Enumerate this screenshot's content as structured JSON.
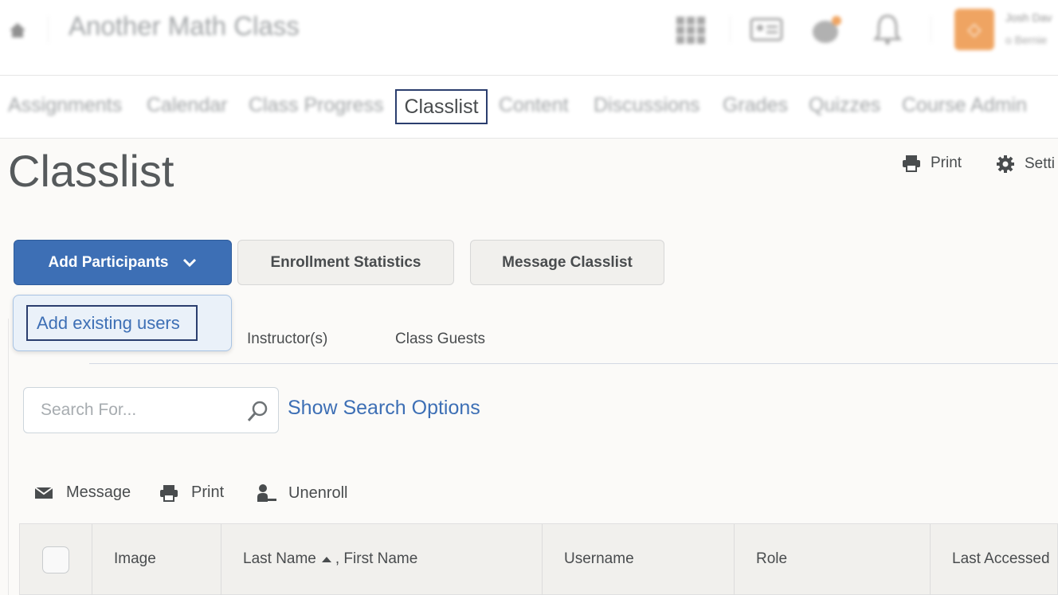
{
  "header": {
    "course_title": "Another Math Class",
    "user_name": "Josh Dav",
    "user_sub": "o Bernie",
    "avatar_initial": "◇"
  },
  "nav": {
    "items": [
      "Assignments",
      "Calendar",
      "Class Progress",
      "Classlist",
      "Content",
      "Discussions",
      "Grades",
      "Quizzes",
      "Course Admin"
    ],
    "active_index": 3
  },
  "page": {
    "title": "Classlist",
    "print_label": "Print",
    "settings_label": "Setti"
  },
  "buttons": {
    "add_participants": "Add Participants",
    "enrollment_statistics": "Enrollment Statistics",
    "message_classlist": "Message Classlist"
  },
  "dropdown": {
    "item": "Add existing users"
  },
  "tabs": [
    "Instructor(s)",
    "Class Guests"
  ],
  "search": {
    "placeholder": "Search For...",
    "options_link": "Show Search Options"
  },
  "actions": {
    "message": "Message",
    "print": "Print",
    "unenroll": "Unenroll"
  },
  "table": {
    "columns": [
      "Image",
      "Last Name",
      ", First Name",
      "Username",
      "Role",
      "Last Accessed"
    ]
  },
  "colors": {
    "primary": "#3d6fb5",
    "highlight_border": "#2b3e6e",
    "avatar": "#e8750f"
  }
}
